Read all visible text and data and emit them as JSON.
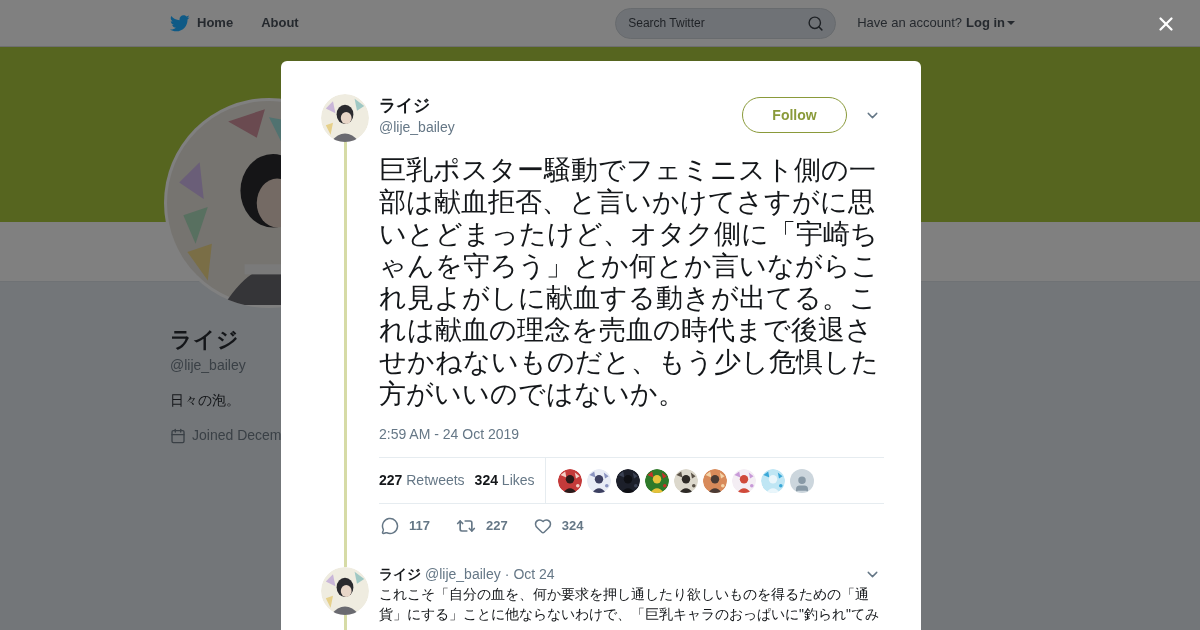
{
  "header": {
    "nav": [
      {
        "label": "Home"
      },
      {
        "label": "About"
      }
    ],
    "search": {
      "placeholder": "Search Twitter"
    },
    "account_prompt": "Have an account?",
    "login": "Log in"
  },
  "profile": {
    "name": "ライジ",
    "handle": "@lije_bailey",
    "bio": "日々の泡。",
    "joined": "Joined Decem"
  },
  "tweet": {
    "name": "ライジ",
    "handle": "@lije_bailey",
    "follow": "Follow",
    "text": "巨乳ポスター騒動でフェミニスト側の一部は献血拒否、と言いかけてさすがに思いとどまったけど、オタク側に「宇崎ちゃんを守ろう」とか何とか言いながらこれ見よがしに献血する動きが出てる。これは献血の理念を売血の時代まで後退させかねないものだと、もう少し危惧した方がいいのではないか。",
    "timestamp": "2:59 AM - 24 Oct 2019",
    "retweet_count": "227",
    "retweet_label": "Retweets",
    "like_count": "324",
    "like_label": "Likes",
    "likers": [
      {
        "kind": "picture"
      },
      {
        "kind": "picture"
      },
      {
        "kind": "picture"
      },
      {
        "kind": "picture"
      },
      {
        "kind": "picture"
      },
      {
        "kind": "picture"
      },
      {
        "kind": "picture"
      },
      {
        "kind": "picture"
      },
      {
        "kind": "default"
      }
    ],
    "actions": [
      {
        "kind": "reply",
        "count": "117"
      },
      {
        "kind": "retweet",
        "count": "227"
      },
      {
        "kind": "like",
        "count": "324"
      }
    ]
  },
  "reply": {
    "name": "ライジ",
    "handle": "@lije_bailey",
    "separator": "·",
    "date": "Oct 24",
    "text": "これこそ「自分の血を、何か要求を押し通したり欲しいものを得るための「通貨」にする」ことに他ならないわけで、「巨乳キャラのおっぱいに\"釣られ\"てみ"
  }
}
